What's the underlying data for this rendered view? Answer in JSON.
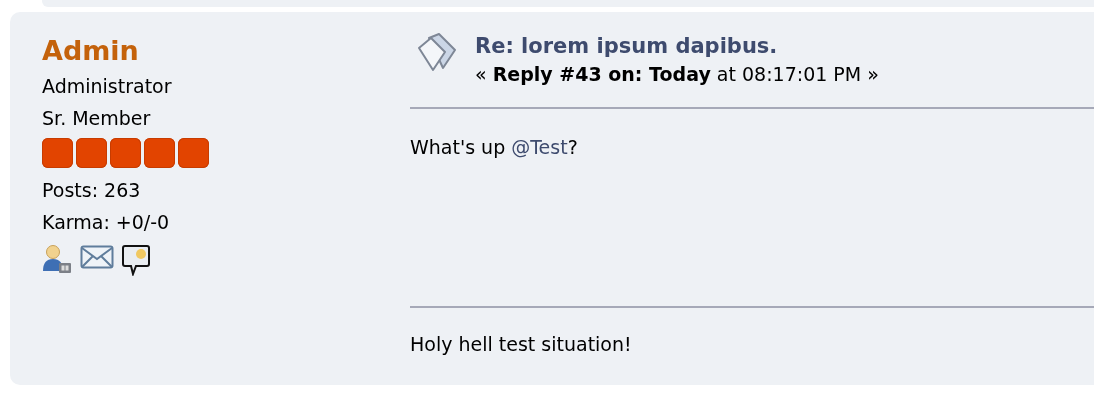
{
  "poster": {
    "name": "Admin",
    "titles": [
      "Administrator",
      "Sr. Member"
    ],
    "stars": 5,
    "posts": "Posts: 263",
    "karma": "Karma: +0/-0"
  },
  "post": {
    "subject": "Re: lorem ipsum dapibus.",
    "meta": "« **Reply #43 on: Today** at 08:17:01 PM »",
    "body": [
      {
        "kind": "text",
        "text": "What's up "
      },
      {
        "kind": "mention",
        "text": "@Test"
      },
      {
        "kind": "text",
        "text": "?"
      }
    ],
    "signature": "Holy hell test situation!"
  }
}
